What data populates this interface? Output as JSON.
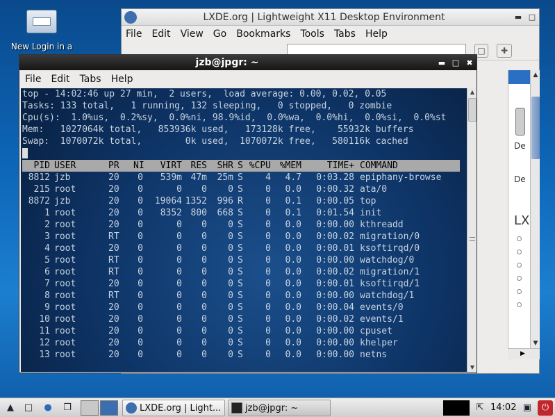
{
  "desktop": {
    "icon_label": "New Login in a"
  },
  "browser": {
    "title": "LXDE.org | Lightweight X11 Desktop Environment",
    "menu": [
      "File",
      "Edit",
      "View",
      "Go",
      "Bookmarks",
      "Tools",
      "Tabs",
      "Help"
    ],
    "side_text": [
      "De",
      "De"
    ],
    "side_logo": "LX"
  },
  "terminal": {
    "title": "jzb@jpgr: ~",
    "menu": [
      "File",
      "Edit",
      "Tabs",
      "Help"
    ],
    "summary": [
      "top - 14:02:46 up 27 min,  2 users,  load average: 0.00, 0.02, 0.05",
      "Tasks: 133 total,   1 running, 132 sleeping,   0 stopped,   0 zombie",
      "Cpu(s):  1.0%us,  0.2%sy,  0.0%ni, 98.9%id,  0.0%wa,  0.0%hi,  0.0%si,  0.0%st",
      "Mem:   1027064k total,   853936k used,   173128k free,    55932k buffers",
      "Swap:  1070072k total,        0k used,  1070072k free,   580116k cached"
    ],
    "columns": [
      "PID",
      "USER",
      "PR",
      "NI",
      "VIRT",
      "RES",
      "SHR",
      "S",
      "%CPU",
      "%MEM",
      "TIME+",
      "COMMAND"
    ],
    "processes": [
      [
        "8812",
        "jzb",
        "20",
        "0",
        "539m",
        "47m",
        "25m",
        "S",
        "4",
        "4.7",
        "0:03.28",
        "epiphany-browse"
      ],
      [
        "215",
        "root",
        "20",
        "0",
        "0",
        "0",
        "0",
        "S",
        "0",
        "0.0",
        "0:00.32",
        "ata/0"
      ],
      [
        "8872",
        "jzb",
        "20",
        "0",
        "19064",
        "1352",
        "996",
        "R",
        "0",
        "0.1",
        "0:00.05",
        "top"
      ],
      [
        "1",
        "root",
        "20",
        "0",
        "8352",
        "800",
        "668",
        "S",
        "0",
        "0.1",
        "0:01.54",
        "init"
      ],
      [
        "2",
        "root",
        "20",
        "0",
        "0",
        "0",
        "0",
        "S",
        "0",
        "0.0",
        "0:00.00",
        "kthreadd"
      ],
      [
        "3",
        "root",
        "RT",
        "0",
        "0",
        "0",
        "0",
        "S",
        "0",
        "0.0",
        "0:00.02",
        "migration/0"
      ],
      [
        "4",
        "root",
        "20",
        "0",
        "0",
        "0",
        "0",
        "S",
        "0",
        "0.0",
        "0:00.01",
        "ksoftirqd/0"
      ],
      [
        "5",
        "root",
        "RT",
        "0",
        "0",
        "0",
        "0",
        "S",
        "0",
        "0.0",
        "0:00.00",
        "watchdog/0"
      ],
      [
        "6",
        "root",
        "RT",
        "0",
        "0",
        "0",
        "0",
        "S",
        "0",
        "0.0",
        "0:00.02",
        "migration/1"
      ],
      [
        "7",
        "root",
        "20",
        "0",
        "0",
        "0",
        "0",
        "S",
        "0",
        "0.0",
        "0:00.01",
        "ksoftirqd/1"
      ],
      [
        "8",
        "root",
        "RT",
        "0",
        "0",
        "0",
        "0",
        "S",
        "0",
        "0.0",
        "0:00.00",
        "watchdog/1"
      ],
      [
        "9",
        "root",
        "20",
        "0",
        "0",
        "0",
        "0",
        "S",
        "0",
        "0.0",
        "0:00.04",
        "events/0"
      ],
      [
        "10",
        "root",
        "20",
        "0",
        "0",
        "0",
        "0",
        "S",
        "0",
        "0.0",
        "0:00.02",
        "events/1"
      ],
      [
        "11",
        "root",
        "20",
        "0",
        "0",
        "0",
        "0",
        "S",
        "0",
        "0.0",
        "0:00.00",
        "cpuset"
      ],
      [
        "12",
        "root",
        "20",
        "0",
        "0",
        "0",
        "0",
        "S",
        "0",
        "0.0",
        "0:00.00",
        "khelper"
      ],
      [
        "13",
        "root",
        "20",
        "0",
        "0",
        "0",
        "0",
        "S",
        "0",
        "0.0",
        "0:00.00",
        "netns"
      ]
    ]
  },
  "taskbar": {
    "tasks": [
      {
        "label": "LXDE.org | Light..."
      },
      {
        "label": "jzb@jpgr: ~"
      }
    ],
    "clock": "14:02"
  }
}
